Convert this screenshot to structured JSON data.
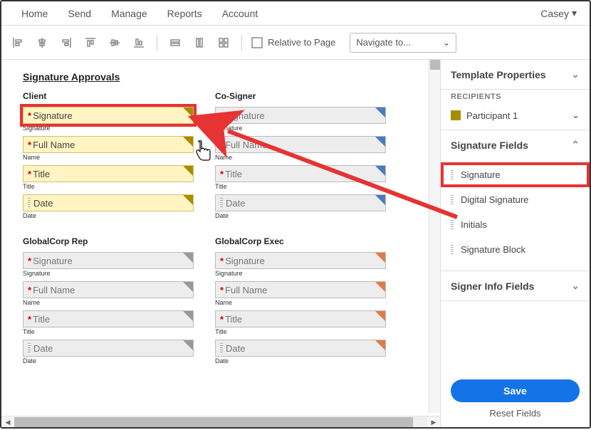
{
  "topnav": {
    "items": [
      "Home",
      "Send",
      "Manage",
      "Reports",
      "Account"
    ],
    "user": "Casey"
  },
  "toolbar": {
    "relative": "Relative to Page",
    "navigate": "Navigate to..."
  },
  "doc": {
    "title": "Signature Approvals",
    "blocks": [
      {
        "title": "Client",
        "color": "yellow",
        "highlight_sig": true,
        "fields": {
          "sig": "Signature",
          "name": "Full Name",
          "title": "Title",
          "date": "Date"
        },
        "labels": {
          "sig": "Signature",
          "name": "Name",
          "title": "Title",
          "date": "Date"
        }
      },
      {
        "title": "Co-Signer",
        "color": "blue",
        "fields": {
          "sig": "Signature",
          "name": "Full Name",
          "title": "Title",
          "date": "Date"
        },
        "labels": {
          "sig": "Signature",
          "name": "Name",
          "title": "Title",
          "date": "Date"
        }
      },
      {
        "title": "GlobalCorp Rep",
        "color": "grey",
        "fields": {
          "sig": "Signature",
          "name": "Full Name",
          "title": "Title",
          "date": "Date"
        },
        "labels": {
          "sig": "Signature",
          "name": "Name",
          "title": "Title",
          "date": "Date"
        }
      },
      {
        "title": "GlobalCorp Exec",
        "color": "orange",
        "fields": {
          "sig": "Signature",
          "name": "Full Name",
          "title": "Title",
          "date": "Date"
        },
        "labels": {
          "sig": "Signature",
          "name": "Name",
          "title": "Title",
          "date": "Date"
        }
      }
    ]
  },
  "sidebar": {
    "template_props": "Template Properties",
    "recipients_label": "RECIPIENTS",
    "recipient": "Participant 1",
    "sig_fields_header": "Signature Fields",
    "sig_fields": [
      "Signature",
      "Digital Signature",
      "Initials",
      "Signature Block"
    ],
    "signer_info_header": "Signer Info Fields",
    "save": "Save",
    "reset": "Reset Fields"
  }
}
